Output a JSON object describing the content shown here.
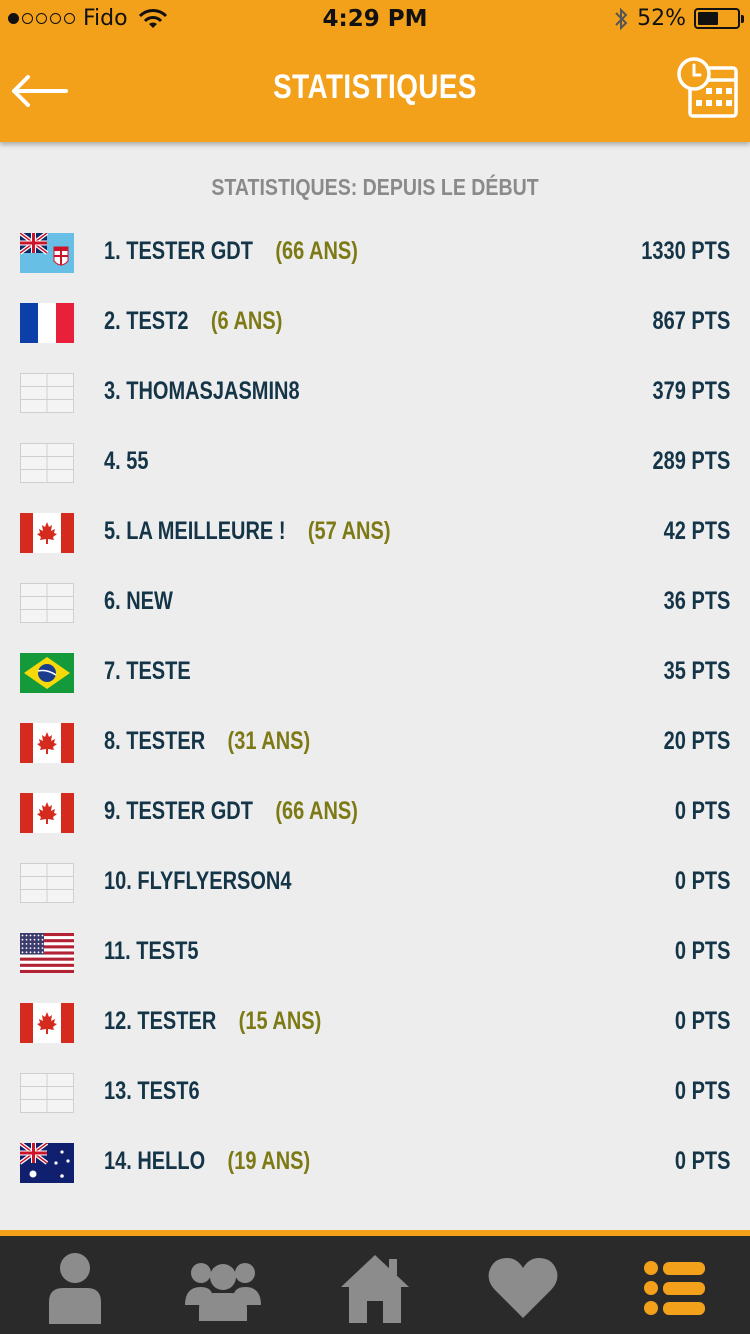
{
  "status_bar": {
    "signal_label": "●○○○○",
    "carrier": "Fido",
    "time": "4:29 PM",
    "battery": "52%",
    "battery_level": 0.52
  },
  "header": {
    "title": "STATISTIQUES",
    "back_icon": "arrow-left-icon",
    "calendar_icon": "calendar-clock-icon"
  },
  "subtitle": "STATISTIQUES: DEPUIS LE DÉBUT",
  "rows": [
    {
      "rank": "1. TESTER GDT",
      "age": "(66 ANS)",
      "points": "1330 PTS",
      "flag": "fiji"
    },
    {
      "rank": "2. TEST2",
      "age": "(6 ANS)",
      "points": "867 PTS",
      "flag": "france"
    },
    {
      "rank": "3. THOMASJASMIN8",
      "age": "",
      "points": "379 PTS",
      "flag": "none"
    },
    {
      "rank": "4. 55",
      "age": "",
      "points": "289 PTS",
      "flag": "none"
    },
    {
      "rank": "5. LA MEILLEURE !",
      "age": "(57 ANS)",
      "points": "42 PTS",
      "flag": "canada"
    },
    {
      "rank": "6. NEW",
      "age": "",
      "points": "36 PTS",
      "flag": "none"
    },
    {
      "rank": "7. TESTE",
      "age": "",
      "points": "35 PTS",
      "flag": "brazil"
    },
    {
      "rank": "8. TESTER",
      "age": "(31 ANS)",
      "points": "20 PTS",
      "flag": "canada"
    },
    {
      "rank": "9. TESTER GDT",
      "age": "(66 ANS)",
      "points": "0 PTS",
      "flag": "canada"
    },
    {
      "rank": "10. FLYFLYERSON4",
      "age": "",
      "points": "0 PTS",
      "flag": "none"
    },
    {
      "rank": "11. TEST5",
      "age": "",
      "points": "0 PTS",
      "flag": "usa"
    },
    {
      "rank": "12. TESTER",
      "age": "(15 ANS)",
      "points": "0 PTS",
      "flag": "canada"
    },
    {
      "rank": "13. TEST6",
      "age": "",
      "points": "0 PTS",
      "flag": "none"
    },
    {
      "rank": "14. HELLO",
      "age": "(19 ANS)",
      "points": "0 PTS",
      "flag": "australia"
    }
  ],
  "tabbar": {
    "tabs": [
      {
        "icon": "person-icon"
      },
      {
        "icon": "group-icon"
      },
      {
        "icon": "home-icon"
      },
      {
        "icon": "heart-icon"
      },
      {
        "icon": "list-icon",
        "active": true
      }
    ]
  },
  "colors": {
    "accent": "#f3a11b",
    "text_dark": "#143447",
    "age_text": "#7d7a16",
    "tab_inactive": "#8c8c8c"
  }
}
